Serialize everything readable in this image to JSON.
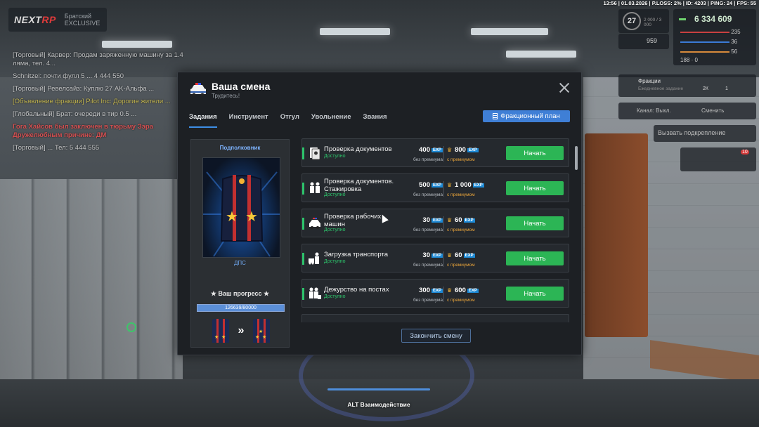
{
  "logo": {
    "prefix": "NEXT",
    "suffix": "RP",
    "server": "Братский",
    "server_sub": "EXCLUSIVE"
  },
  "chat": [
    {
      "text": "[Торговый] Карвер: Продам заряженную машину за 1.4 ляма, тел. 4...",
      "color": "w"
    },
    {
      "text": "Schnitzel: почти фулл 5 ... 4 444 550",
      "color": "w"
    },
    {
      "text": "[Торговый] Ревелсайз: Куплю 27 AK-Альфа ...",
      "color": "w"
    },
    {
      "text": "[Объявление фракции] Pilot Inc: Дорогие жители ...",
      "color": "y"
    },
    {
      "text": "[Глобальный] Брат: очереди в тир 0.5 ...",
      "color": "w"
    },
    {
      "text": "Гога Хайсов был заключен в тюрьму Зэра Дружелюбным причине: ДМ",
      "color": "r"
    },
    {
      "text": "[Торговый] ... Тел: 5 444 555",
      "color": "w"
    }
  ],
  "hud": {
    "top_line": "13:56 | 01.03.2026 | P.LOSS: 2% | ID: 4203 | PING: 24 | FPS: 55",
    "level": "27",
    "level_xp": "2 000 / 3 000",
    "xp_small": "959",
    "money": "6 334 609",
    "stats": [
      "235",
      "36",
      "56",
      "0",
      "188"
    ],
    "faction_title": "Фракции",
    "faction_sub": "Ежедневное задание",
    "faction_val1": "2К",
    "faction_val2": "1",
    "channel": "Канал: Выкл.",
    "channel_change": "Сменить",
    "backup": "Вызвать подкрепление",
    "notif_count": "10"
  },
  "modal": {
    "title": "Ваша смена",
    "subtitle": "Трудитесь!",
    "plan_button": "Фракционный план",
    "tabs": [
      "Задания",
      "Инструмент",
      "Отгул",
      "Увольнение",
      "Звания"
    ],
    "active_tab": 0,
    "finish_button": "Закончить смену"
  },
  "rank": {
    "name": "Подполковник",
    "dept": "ДПС",
    "progress_label": "★ Ваш прогресс ★",
    "progress_value": 126639,
    "progress_max": 80000,
    "progress_text": "126639/80000"
  },
  "tasks": [
    {
      "name": "Проверка документов",
      "status": "Доступно",
      "exp": "400",
      "exp_premium": "800",
      "no_prem": "без премиума",
      "prem": "с премиумом",
      "button": "Начать",
      "icon": "documents-icon"
    },
    {
      "name": "Проверка документов. Стажировка",
      "status": "Доступно",
      "exp": "500",
      "exp_premium": "1 000",
      "no_prem": "без премиума",
      "prem": "с премиумом",
      "button": "Начать",
      "icon": "officers-icon"
    },
    {
      "name": "Проверка рабочих машин",
      "status": "Доступно",
      "exp": "30",
      "exp_premium": "60",
      "no_prem": "без премиума",
      "prem": "с премиумом",
      "button": "Начать",
      "icon": "police-car-icon"
    },
    {
      "name": "Загрузка транспорта",
      "status": "Доступно",
      "exp": "30",
      "exp_premium": "60",
      "no_prem": "без премиума",
      "prem": "с премиумом",
      "button": "Начать",
      "icon": "loading-icon"
    },
    {
      "name": "Дежурство на постах",
      "status": "Доступно",
      "exp": "300",
      "exp_premium": "600",
      "no_prem": "без премиума",
      "prem": "с премиумом",
      "button": "Начать",
      "icon": "post-duty-icon"
    }
  ],
  "exp_tag": "EXP",
  "interaction": "ALT Взаимодействие",
  "colors": {
    "accent": "#3e8ee6",
    "start": "#2cb555",
    "status": "#2dc46b",
    "premium": "#e7a33a"
  }
}
